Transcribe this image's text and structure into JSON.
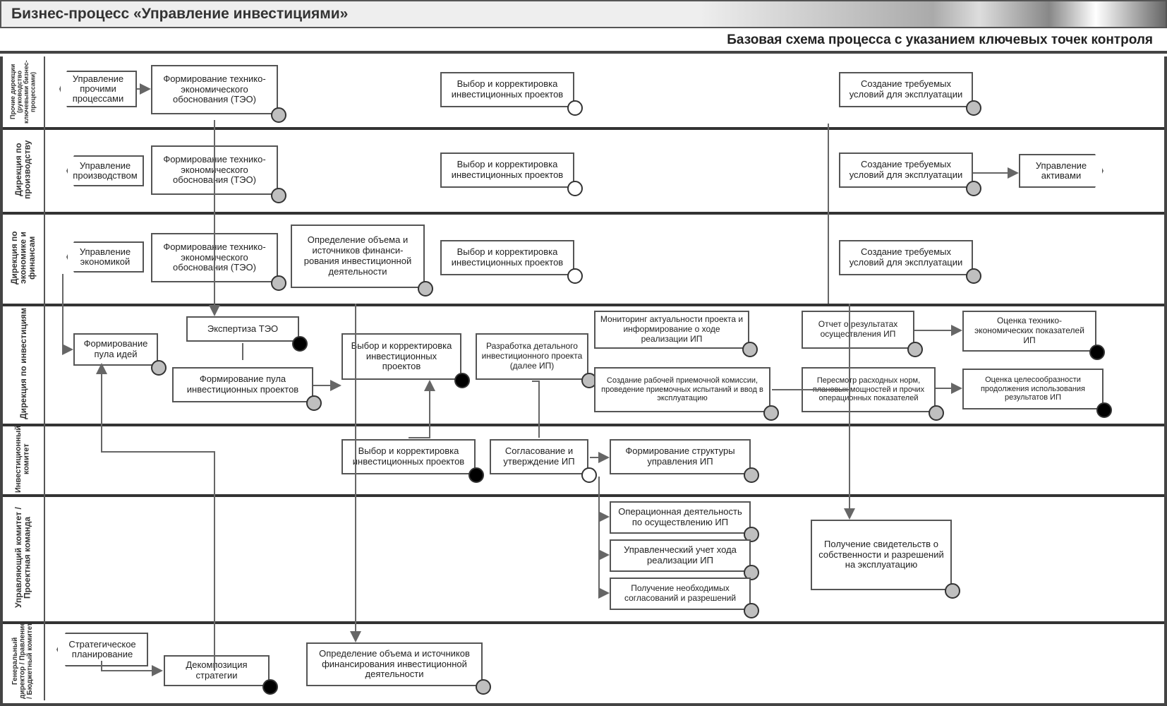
{
  "title": "Бизнес-процесс «Управление инвестициями»",
  "subtitle": "Базовая схема процесса с указанием ключевых точек контроля",
  "lanes": {
    "l1": "Прочие дирекции (руководство ключевыми бизнес-процессами)",
    "l2": "Дирекция по производству",
    "l3": "Дирекция по экономике и финансам",
    "l4": "Дирекция по инвестициям",
    "l5": "Инвестиционный комитет",
    "l6": "Управляющий комитет / Проектная команда",
    "l7": "Генеральный директор / Правление / Бюджетный комитет"
  },
  "events": {
    "e1": "Управление прочими процессами",
    "e2": "Управление производством",
    "e3": "Управление экономикой",
    "e4": "Управление активами",
    "e5": "Стратегическое планирование"
  },
  "acts": {
    "a_teo": "Формирование технико-экономического обоснования (ТЭО)",
    "a_sel": "Выбор и корректировка инвестиционных проектов",
    "a_cond": "Создание требуемых условий для эксплуатации",
    "a_fin": "Определение объема и источников финансирования инвестиционной деятельности",
    "a_fin2": "Определение объема и источников финанси-рования инвестиционной деятельности",
    "a_pool": "Формирование пула идей",
    "a_pool2": "Формирование пула инвестиционных проектов",
    "a_exp": "Экспертиза ТЭО",
    "a_det": "Разработка детального инвестиционного проекта (далее ИП)",
    "a_appr": "Согласование и утверждение ИП",
    "a_mon": "Мониторинг актуальности проекта и информирование о ходе реализации ИП",
    "a_komm": "Создание рабочей приемочной комиссии, проведение приемочных испытаний и ввод в эксплуатацию",
    "a_rep": "Отчет о результатах осуществления ИП",
    "a_norm": "Пересмотр расходных норм, плановых мощностей и прочих операционных показателей",
    "a_eval1": "Оценка технико-экономических показателей ИП",
    "a_eval2": "Оценка целесообразности продолжения использования результатов ИП",
    "a_struct": "Формирование структуры управления ИП",
    "a_oper": "Операционная деятельность по осуществлению ИП",
    "a_acct": "Управленческий учет хода реализации ИП",
    "a_perm": "Получение необходимых согласований и разрешений",
    "a_cert": "Получение свидетельств о собственности и разрешений на эксплуатацию",
    "a_dec": "Декомпозиция стратегии"
  }
}
